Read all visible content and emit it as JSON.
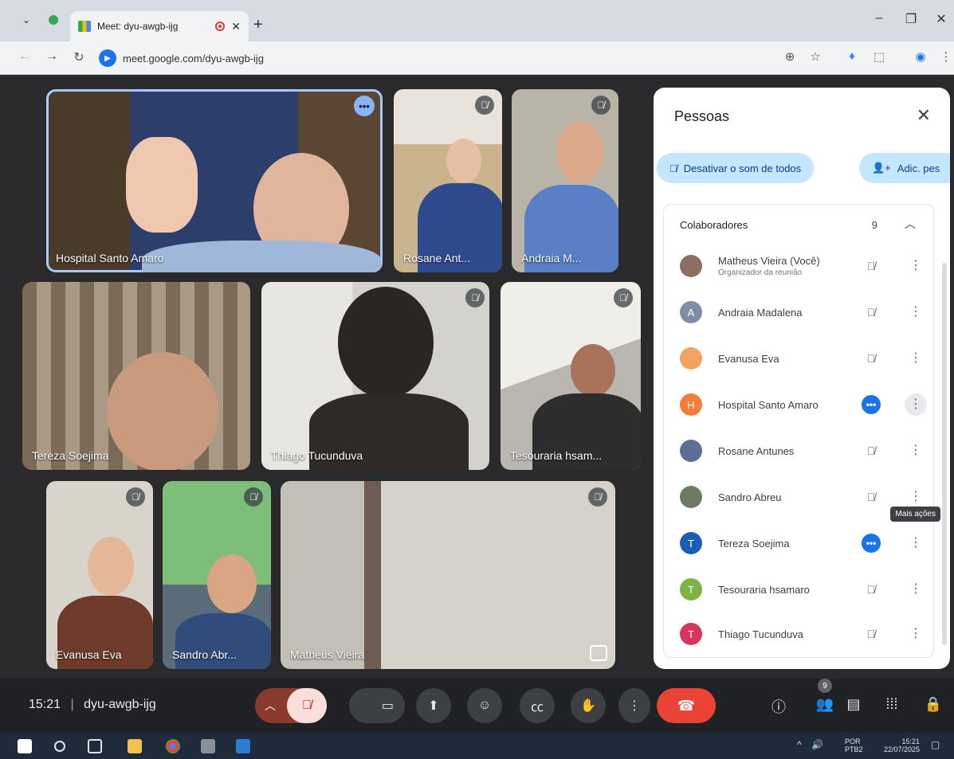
{
  "browser": {
    "tab_title": "Meet: dyu-awgb-ijg",
    "url": "meet.google.com/dyu-awgb-ijg",
    "new_tab": "+"
  },
  "tiles": [
    {
      "name": "Hospital Santo Amaro",
      "status": "speaking"
    },
    {
      "name": "Rosane Ant...",
      "status": "muted"
    },
    {
      "name": "Andraia M...",
      "status": "muted"
    },
    {
      "name": "Tereza Soejima",
      "status": "none"
    },
    {
      "name": "Thiago Tucunduva",
      "status": "muted"
    },
    {
      "name": "Tesouraria hsam...",
      "status": "muted"
    },
    {
      "name": "Evanusa Eva",
      "status": "muted"
    },
    {
      "name": "Sandro Abr...",
      "status": "muted"
    },
    {
      "name": "Matheus Vieira",
      "status": "muted"
    }
  ],
  "panel": {
    "title": "Pessoas",
    "mute_all_label": "Desativar o som de todos",
    "add_people_label": "Adic. pes",
    "section_label": "Colaboradores",
    "section_count": "9",
    "tooltip": "Mais ações",
    "people": [
      {
        "name": "Matheus Vieira (Você)",
        "subtitle": "Organizador da reunião",
        "initial": "",
        "color": "#8d6e63",
        "status": "muted"
      },
      {
        "name": "Andraia Madalena",
        "subtitle": "",
        "initial": "A",
        "color": "#7f8ea3",
        "status": "muted"
      },
      {
        "name": "Evanusa Eva",
        "subtitle": "",
        "initial": "",
        "color": "#f4a261",
        "status": "muted"
      },
      {
        "name": "Hospital Santo Amaro",
        "subtitle": "",
        "initial": "H",
        "color": "#f57c3a",
        "status": "speaking"
      },
      {
        "name": "Rosane Antunes",
        "subtitle": "",
        "initial": "",
        "color": "#5b6f94",
        "status": "muted"
      },
      {
        "name": "Sandro Abreu",
        "subtitle": "",
        "initial": "",
        "color": "#6d7b66",
        "status": "muted"
      },
      {
        "name": "Tereza Soejima",
        "subtitle": "",
        "initial": "T",
        "color": "#1a5fb4",
        "status": "speaking"
      },
      {
        "name": "Tesouraria hsamaro",
        "subtitle": "",
        "initial": "T",
        "color": "#7cb342",
        "status": "muted"
      },
      {
        "name": "Thiago Tucunduva",
        "subtitle": "",
        "initial": "T",
        "color": "#d6365b",
        "status": "muted"
      }
    ]
  },
  "controls": {
    "time": "15:21",
    "meeting_code": "dyu-awgb-ijg",
    "people_count": "9"
  },
  "taskbar": {
    "lang_top": "POR",
    "lang_bottom": "PTB2",
    "clock_time": "15:21",
    "clock_date": "22/07/2025"
  }
}
